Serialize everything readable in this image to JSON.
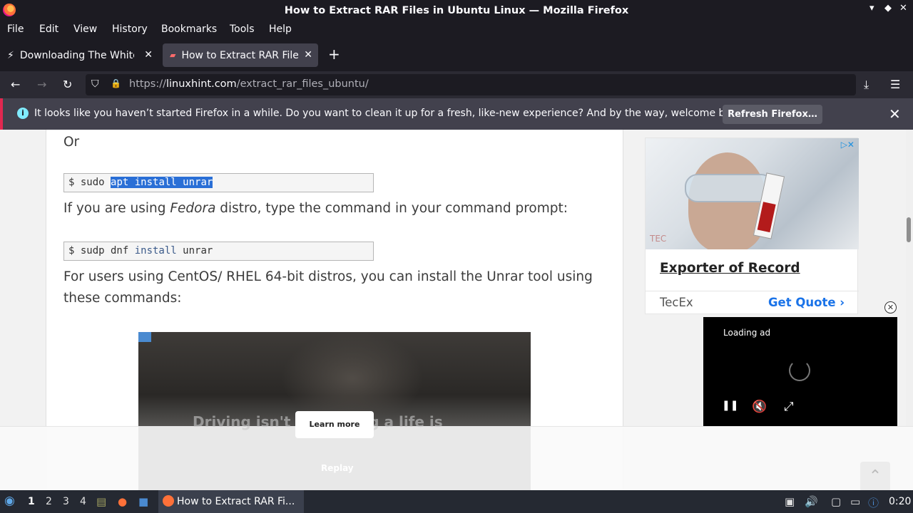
{
  "window": {
    "title": "How to Extract RAR Files in Ubuntu Linux — Mozilla Firefox",
    "minimize": "▾",
    "restore": "◆",
    "close": "✕"
  },
  "menu": {
    "file": "File",
    "edit": "Edit",
    "view": "View",
    "history": "History",
    "bookmarks": "Bookmarks",
    "tools": "Tools",
    "help": "Help"
  },
  "tabs": [
    {
      "label": "Downloading The White House",
      "close": "✕",
      "icon": "lightning-icon"
    },
    {
      "label": "How to Extract RAR Files in Ubuntu",
      "close": "✕",
      "icon": "page-icon"
    }
  ],
  "new_tab": "+",
  "nav": {
    "back": "←",
    "forward": "→",
    "reload": "↻",
    "shield": "⛉",
    "lock": "🔒",
    "url_prefix": "https://",
    "url_domain": "linuxhint.com",
    "url_path": "/extract_rar_files_ubuntu/",
    "reader": "▤",
    "bookmark": "☆",
    "downloads": "⤓",
    "menu": "☰"
  },
  "notification": {
    "icon": "i",
    "message": "It looks like you haven’t started Firefox in a while. Do you want to clean it up for a fresh, like-new experience? And by the way, welcome back!",
    "button": "Refresh Firefox…",
    "close": "✕"
  },
  "article": {
    "or": "Or",
    "code1_prompt": "$ sudo ",
    "code1_selected": "apt install unrar",
    "fedora_pre": "If you are using ",
    "fedora_em": "Fedora",
    "fedora_post": " distro, type the command in your command prompt:",
    "code2_prompt": "$ sudp dnf ",
    "code2_kw": "install",
    "code2_rest": " unrar",
    "centos_line1": "For users using CentOS/ RHEL 64-bit distros, you can install the Unrar tool using",
    "centos_line2": "these commands:"
  },
  "sidebar_ad": {
    "title": "Exporter of Record",
    "brand": "TecEx",
    "cta": "Get Quote ›",
    "logo_text": "TEC",
    "adchoices": "▷✕"
  },
  "video_ad": {
    "loading": "Loading ad",
    "close": "✕",
    "pause": "❚❚",
    "mute": "🔇",
    "fullscreen": "⤢"
  },
  "inline_ad": {
    "learn_more": "Learn more",
    "headline": "Driving isn't e... saving a life is",
    "replay": "Replay"
  },
  "back_to_top": "⌃",
  "taskbar": {
    "workspaces": [
      "1",
      "2",
      "3",
      "4"
    ],
    "active_task": "How to Extract RAR Fi...",
    "clock": "0:20"
  }
}
